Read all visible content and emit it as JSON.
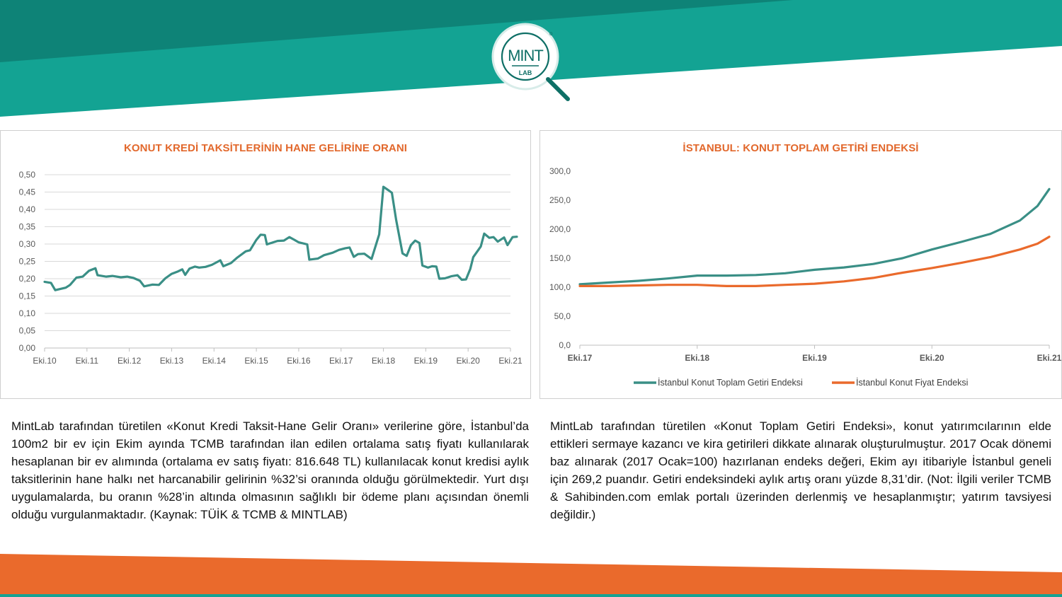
{
  "colors": {
    "teal": "#13a393",
    "teal_dark": "#0e8377",
    "orange": "#ea6a2c",
    "line_teal": "#3a8f86",
    "title_orange": "#e2682c"
  },
  "logo": {
    "top_text": "MINT",
    "bottom_text": "LAB",
    "degree": "o"
  },
  "chart_data": [
    {
      "type": "line",
      "title": "KONUT KREDİ TAKSİTLERİNİN HANE GELİRİNE ORANI",
      "ylim": [
        0,
        0.5
      ],
      "yticks": [
        "0,50",
        "0,45",
        "0,40",
        "0,35",
        "0,30",
        "0,25",
        "0,20",
        "0,15",
        "0,10",
        "0,05",
        "0,00"
      ],
      "xticks": [
        "Eki.10",
        "Eki.11",
        "Eki.12",
        "Eki.13",
        "Eki.14",
        "Eki.15",
        "Eki.16",
        "Eki.17",
        "Eki.18",
        "Eki.19",
        "Eki.20",
        "Eki.21"
      ],
      "x_range": [
        0,
        11
      ],
      "grid": true,
      "series": [
        {
          "color": "#3a8f86",
          "points": [
            [
              0,
              0.191
            ],
            [
              0.15,
              0.188
            ],
            [
              0.25,
              0.167
            ],
            [
              0.5,
              0.174
            ],
            [
              0.6,
              0.182
            ],
            [
              0.75,
              0.203
            ],
            [
              0.9,
              0.206
            ],
            [
              1.05,
              0.223
            ],
            [
              1.2,
              0.23
            ],
            [
              1.25,
              0.21
            ],
            [
              1.45,
              0.206
            ],
            [
              1.6,
              0.208
            ],
            [
              1.8,
              0.204
            ],
            [
              1.95,
              0.206
            ],
            [
              2.1,
              0.202
            ],
            [
              2.25,
              0.194
            ],
            [
              2.35,
              0.178
            ],
            [
              2.55,
              0.183
            ],
            [
              2.7,
              0.182
            ],
            [
              2.85,
              0.201
            ],
            [
              3.0,
              0.214
            ],
            [
              3.15,
              0.221
            ],
            [
              3.25,
              0.227
            ],
            [
              3.32,
              0.211
            ],
            [
              3.42,
              0.229
            ],
            [
              3.55,
              0.235
            ],
            [
              3.65,
              0.232
            ],
            [
              3.8,
              0.234
            ],
            [
              3.95,
              0.24
            ],
            [
              4.15,
              0.253
            ],
            [
              4.22,
              0.236
            ],
            [
              4.4,
              0.245
            ],
            [
              4.55,
              0.261
            ],
            [
              4.75,
              0.279
            ],
            [
              4.85,
              0.282
            ],
            [
              5.0,
              0.312
            ],
            [
              5.1,
              0.327
            ],
            [
              5.2,
              0.326
            ],
            [
              5.25,
              0.299
            ],
            [
              5.5,
              0.309
            ],
            [
              5.65,
              0.31
            ],
            [
              5.78,
              0.32
            ],
            [
              5.9,
              0.312
            ],
            [
              6.0,
              0.305
            ],
            [
              6.2,
              0.299
            ],
            [
              6.25,
              0.255
            ],
            [
              6.45,
              0.258
            ],
            [
              6.6,
              0.268
            ],
            [
              6.8,
              0.275
            ],
            [
              6.95,
              0.283
            ],
            [
              7.1,
              0.288
            ],
            [
              7.2,
              0.29
            ],
            [
              7.3,
              0.263
            ],
            [
              7.4,
              0.271
            ],
            [
              7.55,
              0.272
            ],
            [
              7.65,
              0.263
            ],
            [
              7.72,
              0.257
            ],
            [
              7.9,
              0.328
            ],
            [
              8.0,
              0.465
            ],
            [
              8.12,
              0.455
            ],
            [
              8.2,
              0.448
            ],
            [
              8.3,
              0.37
            ],
            [
              8.45,
              0.273
            ],
            [
              8.55,
              0.266
            ],
            [
              8.65,
              0.297
            ],
            [
              8.75,
              0.31
            ],
            [
              8.85,
              0.303
            ],
            [
              8.92,
              0.238
            ],
            [
              9.05,
              0.232
            ],
            [
              9.15,
              0.236
            ],
            [
              9.25,
              0.235
            ],
            [
              9.32,
              0.2
            ],
            [
              9.45,
              0.201
            ],
            [
              9.6,
              0.207
            ],
            [
              9.75,
              0.21
            ],
            [
              9.85,
              0.197
            ],
            [
              9.95,
              0.198
            ],
            [
              10.05,
              0.228
            ],
            [
              10.12,
              0.262
            ],
            [
              10.3,
              0.293
            ],
            [
              10.38,
              0.33
            ],
            [
              10.5,
              0.318
            ],
            [
              10.6,
              0.32
            ],
            [
              10.7,
              0.307
            ],
            [
              10.85,
              0.319
            ],
            [
              10.93,
              0.297
            ],
            [
              11.05,
              0.32
            ],
            [
              11.15,
              0.321
            ]
          ]
        }
      ]
    },
    {
      "type": "line",
      "title": "İSTANBUL: KONUT TOPLAM GETİRİ ENDEKSİ",
      "ylim": [
        0,
        300
      ],
      "yticks": [
        "300,0",
        "250,0",
        "200,0",
        "150,0",
        "100,0",
        "50,0",
        "0,0"
      ],
      "xticks": [
        "Eki.17",
        "Eki.18",
        "Eki.19",
        "Eki.20",
        "Eki.21"
      ],
      "x_range": [
        0,
        4
      ],
      "grid": false,
      "legend_position": "bottom",
      "series": [
        {
          "name": "İstanbul Konut Toplam Getiri Endeksi",
          "color": "#3a8f86",
          "points": [
            [
              0,
              105
            ],
            [
              0.25,
              108
            ],
            [
              0.5,
              111
            ],
            [
              0.75,
              115
            ],
            [
              1.0,
              120
            ],
            [
              1.25,
              120
            ],
            [
              1.5,
              121
            ],
            [
              1.75,
              124
            ],
            [
              2.0,
              130
            ],
            [
              2.25,
              134
            ],
            [
              2.5,
              140
            ],
            [
              2.75,
              150
            ],
            [
              3.0,
              165
            ],
            [
              3.25,
              178
            ],
            [
              3.5,
              192
            ],
            [
              3.75,
              215
            ],
            [
              3.9,
              240
            ],
            [
              4.0,
              269.2
            ]
          ]
        },
        {
          "name": "İstanbul Konut Fiyat Endeksi",
          "color": "#ea6a2c",
          "points": [
            [
              0,
              102
            ],
            [
              0.25,
              102
            ],
            [
              0.5,
              103
            ],
            [
              0.75,
              104
            ],
            [
              1.0,
              104
            ],
            [
              1.25,
              102
            ],
            [
              1.5,
              102
            ],
            [
              1.75,
              104
            ],
            [
              2.0,
              106
            ],
            [
              2.25,
              110
            ],
            [
              2.5,
              116
            ],
            [
              2.75,
              125
            ],
            [
              3.0,
              133
            ],
            [
              3.25,
              142
            ],
            [
              3.5,
              152
            ],
            [
              3.75,
              165
            ],
            [
              3.9,
              175
            ],
            [
              4.0,
              187
            ]
          ]
        }
      ]
    }
  ],
  "paragraphs": {
    "left": "MintLab tarafından türetilen «Konut Kredi Taksit-Hane Gelir Oranı» verilerine göre, İstanbul’da 100m2 bir ev için Ekim ayında TCMB tarafından ilan edilen ortalama satış fiyatı kullanılarak hesaplanan bir ev alımında (ortalama ev satış fiyatı: 816.648 TL) kullanılacak konut kredisi aylık taksitlerinin hane halkı net harcanabilir gelirinin %32’si oranında olduğu görülmektedir. Yurt dışı uygulamalarda, bu oranın %28’in altında olmasının sağlıklı bir ödeme planı açısından önemli olduğu vurgulanmaktadır. (Kaynak: TÜİK & TCMB & MINTLAB)",
    "right": "MintLab tarafından türetilen «Konut Toplam Getiri Endeksi», konut yatırımcılarının elde ettikleri sermaye kazancı ve kira getirileri dikkate alınarak oluşturulmuştur. 2017 Ocak dönemi baz alınarak (2017 Ocak=100) hazırlanan endeks değeri, Ekim ayı itibariyle İstanbul geneli için 269,2 puandır. Getiri endeksindeki aylık artış oranı yüzde 8,31’dir. (Not: İlgili veriler TCMB & Sahibinden.com emlak portalı üzerinden derlenmiş ve hesaplanmıştır; yatırım tavsiyesi değildir.)"
  }
}
